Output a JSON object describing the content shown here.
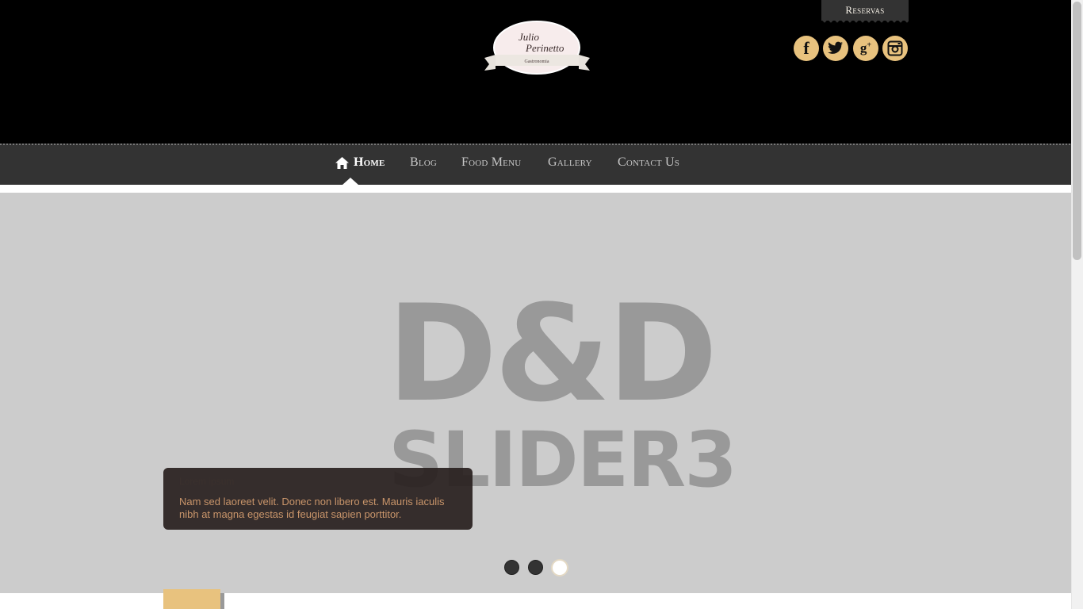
{
  "header": {
    "logo": {
      "line1": "Julio",
      "line2": "Perinetto",
      "ribbon": "Gastronomia"
    },
    "reservas_label": "Reservas",
    "social": [
      {
        "name": "facebook-icon",
        "glyph": "f"
      },
      {
        "name": "twitter-icon",
        "glyph": "t"
      },
      {
        "name": "google-plus-icon",
        "glyph": "g+"
      },
      {
        "name": "instagram-icon",
        "glyph": "ig"
      }
    ]
  },
  "nav": {
    "items": [
      {
        "label": "Home",
        "active": true
      },
      {
        "label": "Blog",
        "active": false
      },
      {
        "label": "Food Menu",
        "active": false
      },
      {
        "label": "Gallery",
        "active": false
      },
      {
        "label": "Contact Us",
        "active": false
      }
    ]
  },
  "slider": {
    "image_text_line1": "D&D",
    "image_text_line2": "SLIDER3",
    "caption_title": "Lorem ipsum",
    "caption_text": "Nam sed laoreet velit. Donec non libero est. Mauris iaculis nibh at magna egestas id feugiat sapien porttitor.",
    "pagination": {
      "count": 3,
      "active_index": 2
    }
  },
  "colors": {
    "header_bg": "#000000",
    "nav_bg": "#333333",
    "accent": "#e8c27e",
    "slider_bg": "#cccccc",
    "caption_text": "#c9956a"
  }
}
